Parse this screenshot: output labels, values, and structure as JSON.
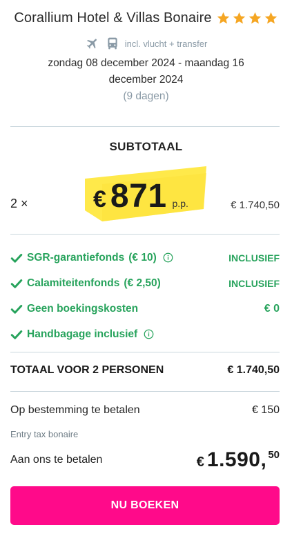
{
  "header": {
    "hotel_name": "Corallium Hotel & Villas Bonaire",
    "stars": 4,
    "star_color": "#f5a623",
    "icons": [
      "airplane-icon",
      "bus-icon"
    ],
    "incl_text": "incl. vlucht + transfer",
    "dates": "zondag 08 december 2024 - maandag 16 december 2024",
    "days": "(9 dagen)"
  },
  "subtotal": {
    "title": "SUBTOTAAL",
    "quantity": "2 ×",
    "currency": "€",
    "price": "871",
    "per_person": "p.p.",
    "total": "€ 1.740,50",
    "highlight_color": "#ffe94a"
  },
  "inclusions": [
    {
      "label": "SGR-garantiefonds",
      "amount": "(€ 10)",
      "has_info": true,
      "value": "INCLUSIEF"
    },
    {
      "label": "Calamiteitenfonds",
      "amount": "(€ 2,50)",
      "has_info": false,
      "value": "INCLUSIEF"
    },
    {
      "label": "Geen boekingskosten",
      "amount": "",
      "has_info": false,
      "value": "€ 0"
    },
    {
      "label": "Handbagage inclusief",
      "amount": "",
      "has_info": true,
      "value": ""
    }
  ],
  "accent_green": "#27a35c",
  "total": {
    "label": "TOTAAL VOOR 2 PERSONEN",
    "value": "€ 1.740,50"
  },
  "destination": {
    "label": "Op bestemming te betalen",
    "value": "€ 150",
    "note": "Entry tax bonaire"
  },
  "pay": {
    "label": "Aan ons te betalen",
    "currency": "€",
    "main": "1.590,",
    "cents": "50"
  },
  "cta": {
    "label": "NU BOEKEN",
    "color": "#ff0a8a"
  }
}
